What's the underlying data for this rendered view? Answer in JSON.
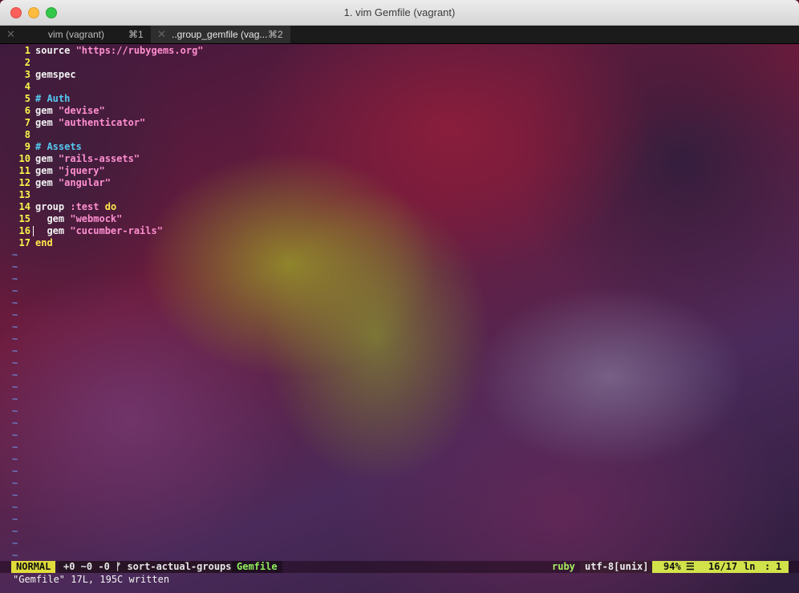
{
  "window": {
    "title": "1. vim Gemfile (vagrant)"
  },
  "tabs": [
    {
      "close": "✕",
      "label": "vim (vagrant)",
      "shortcut": "⌘1"
    },
    {
      "close": "✕",
      "label": "..group_gemfile (vag...",
      "shortcut": "⌘2"
    }
  ],
  "editor": {
    "lines": [
      {
        "n": "1",
        "parts": [
          [
            "t",
            "source "
          ],
          [
            "s",
            "\"https://rubygems.org\""
          ]
        ]
      },
      {
        "n": "2",
        "parts": []
      },
      {
        "n": "3",
        "parts": [
          [
            "t",
            "gemspec"
          ]
        ]
      },
      {
        "n": "4",
        "parts": []
      },
      {
        "n": "5",
        "parts": [
          [
            "c",
            "# Auth"
          ]
        ]
      },
      {
        "n": "6",
        "parts": [
          [
            "t",
            "gem "
          ],
          [
            "s",
            "\"devise\""
          ]
        ]
      },
      {
        "n": "7",
        "parts": [
          [
            "t",
            "gem "
          ],
          [
            "s",
            "\"authenticator\""
          ]
        ]
      },
      {
        "n": "8",
        "parts": []
      },
      {
        "n": "9",
        "parts": [
          [
            "c",
            "# Assets"
          ]
        ]
      },
      {
        "n": "10",
        "parts": [
          [
            "t",
            "gem "
          ],
          [
            "s",
            "\"rails-assets\""
          ]
        ]
      },
      {
        "n": "11",
        "parts": [
          [
            "t",
            "gem "
          ],
          [
            "s",
            "\"jquery\""
          ]
        ]
      },
      {
        "n": "12",
        "parts": [
          [
            "t",
            "gem "
          ],
          [
            "s",
            "\"angular\""
          ]
        ]
      },
      {
        "n": "13",
        "parts": []
      },
      {
        "n": "14",
        "parts": [
          [
            "t",
            "group "
          ],
          [
            "y",
            ":test"
          ],
          [
            "t",
            " "
          ],
          [
            "k",
            "do"
          ]
        ]
      },
      {
        "n": "15",
        "parts": [
          [
            "t",
            "  gem "
          ],
          [
            "s",
            "\"webmock\""
          ]
        ]
      },
      {
        "n": "16",
        "parts": [
          [
            "t",
            "  gem "
          ],
          [
            "s",
            "\"cucumber-rails\""
          ]
        ],
        "cursor": true
      },
      {
        "n": "17",
        "parts": [
          [
            "k",
            "end"
          ]
        ]
      }
    ],
    "tilde": "~",
    "tilde_count": 26
  },
  "statusline": {
    "mode": "NORMAL",
    "vcs": "+0 ~0 -0 ᚠ sort-actual-groups",
    "filename": "Gemfile",
    "filetype": "ruby",
    "encoding": "utf-8[unix]",
    "percent": "94%",
    "percent_icon": "☰",
    "line_col": "16/17",
    "ln_label": "ln",
    "colon": ":",
    "column": "1"
  },
  "command_line": "\"Gemfile\" 17L, 195C written",
  "colors": {
    "line_number": "#f7f74a",
    "string": "#ff8fd0",
    "comment": "#56c8f0",
    "keyword": "#ffe84c",
    "mode_bg": "#e0dc3a",
    "position_bg": "#d2e24a",
    "filename": "#8ff05a"
  }
}
